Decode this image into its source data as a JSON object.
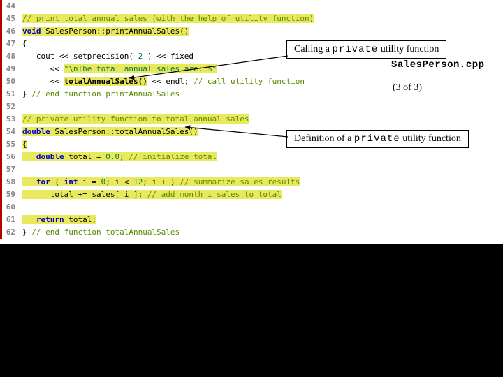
{
  "file_label": "SalesPerson.cpp",
  "page_of": "(3 of 3)",
  "callouts": {
    "call": {
      "pre": "Calling a ",
      "code": "private",
      "post": " utility function"
    },
    "def": {
      "pre": "Definition of a ",
      "code": "private",
      "post": " utility function"
    }
  },
  "lines": [
    {
      "n": 44,
      "seg": []
    },
    {
      "n": 45,
      "seg": [
        {
          "cls": "hl comment",
          "t": "// print total annual sales (with the help of utility function)"
        }
      ]
    },
    {
      "n": 46,
      "seg": [
        {
          "cls": "hl kw",
          "t": "void"
        },
        {
          "cls": "hl plain",
          "t": " SalesPerson::printAnnualSales()"
        }
      ]
    },
    {
      "n": 47,
      "seg": [
        {
          "cls": "plain",
          "t": "{"
        }
      ]
    },
    {
      "n": 48,
      "seg": [
        {
          "cls": "plain",
          "t": "   cout << setprecision( "
        },
        {
          "cls": "num",
          "t": "2"
        },
        {
          "cls": "plain",
          "t": " ) << fixed"
        }
      ]
    },
    {
      "n": 49,
      "seg": [
        {
          "cls": "plain",
          "t": "      << "
        },
        {
          "cls": "hl str",
          "t": "\"\\nThe total annual sales are: $\""
        }
      ]
    },
    {
      "n": 50,
      "seg": [
        {
          "cls": "plain",
          "t": "      << "
        },
        {
          "cls": "hl boldtxt",
          "t": "totalAnnualSales()"
        },
        {
          "cls": "plain",
          "t": " << endl; "
        },
        {
          "cls": "comment",
          "t": "// call utility function"
        }
      ]
    },
    {
      "n": 51,
      "seg": [
        {
          "cls": "plain",
          "t": "} "
        },
        {
          "cls": "comment",
          "t": "// end function printAnnualSales"
        }
      ]
    },
    {
      "n": 52,
      "seg": []
    },
    {
      "n": 53,
      "seg": [
        {
          "cls": "hl comment",
          "t": "// private utility function to total annual sales"
        }
      ]
    },
    {
      "n": 54,
      "seg": [
        {
          "cls": "hl kw",
          "t": "double"
        },
        {
          "cls": "hl plain",
          "t": " SalesPerson::totalAnnualSales()"
        }
      ]
    },
    {
      "n": 55,
      "seg": [
        {
          "cls": "hl plain",
          "t": "{"
        }
      ]
    },
    {
      "n": 56,
      "seg": [
        {
          "cls": "hl kw",
          "t": "   double"
        },
        {
          "cls": "hl plain",
          "t": " total = "
        },
        {
          "cls": "hl num",
          "t": "0.0"
        },
        {
          "cls": "hl plain",
          "t": "; "
        },
        {
          "cls": "hl comment",
          "t": "// initialize total"
        }
      ]
    },
    {
      "n": 57,
      "seg": []
    },
    {
      "n": 58,
      "seg": [
        {
          "cls": "hl kw",
          "t": "   for"
        },
        {
          "cls": "hl plain",
          "t": " ( "
        },
        {
          "cls": "hl kw",
          "t": "int"
        },
        {
          "cls": "hl plain",
          "t": " i = "
        },
        {
          "cls": "hl num",
          "t": "0"
        },
        {
          "cls": "hl plain",
          "t": "; i < "
        },
        {
          "cls": "hl num",
          "t": "12"
        },
        {
          "cls": "hl plain",
          "t": "; i++ ) "
        },
        {
          "cls": "hl comment",
          "t": "// summarize sales results"
        }
      ]
    },
    {
      "n": 59,
      "seg": [
        {
          "cls": "hl plain",
          "t": "      total += sales[ i ]; "
        },
        {
          "cls": "hl comment",
          "t": "// add month i sales to total"
        }
      ]
    },
    {
      "n": 60,
      "seg": []
    },
    {
      "n": 61,
      "seg": [
        {
          "cls": "hl kw",
          "t": "   return"
        },
        {
          "cls": "hl plain",
          "t": " total;"
        }
      ]
    },
    {
      "n": 62,
      "seg": [
        {
          "cls": "plain",
          "t": "} "
        },
        {
          "cls": "comment",
          "t": "// end function totalAnnualSales"
        }
      ]
    }
  ]
}
